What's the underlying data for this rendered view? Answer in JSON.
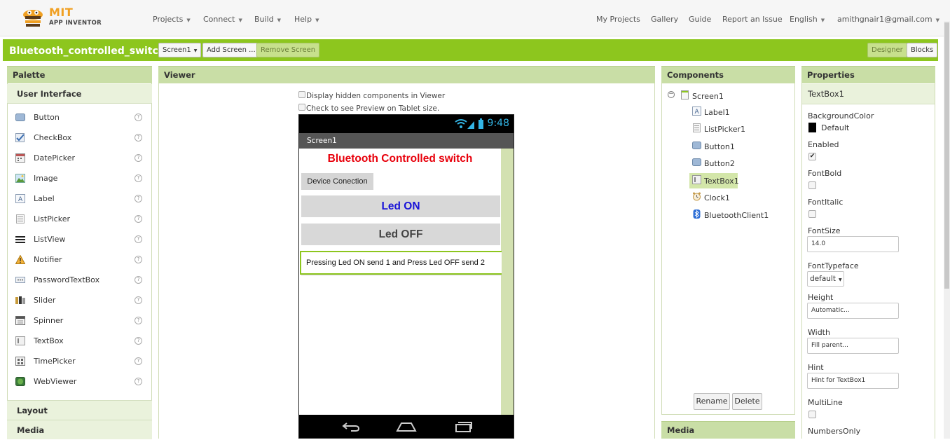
{
  "brand": {
    "line1": "MIT",
    "line2": "APP INVENTOR"
  },
  "nav": {
    "left": [
      "Projects",
      "Connect",
      "Build",
      "Help"
    ],
    "my_projects": "My Projects",
    "gallery": "Gallery",
    "guide": "Guide",
    "report": "Report an Issue",
    "language": "English",
    "user": "amithgnair1@gmail.com"
  },
  "project": {
    "name": "Bluetooth_controlled_switch",
    "screen_select": "Screen1",
    "add_screen": "Add Screen ...",
    "remove_screen": "Remove Screen",
    "designer": "Designer",
    "blocks": "Blocks"
  },
  "palette": {
    "title": "Palette",
    "category": "User Interface",
    "items": [
      "Button",
      "CheckBox",
      "DatePicker",
      "Image",
      "Label",
      "ListPicker",
      "ListView",
      "Notifier",
      "PasswordTextBox",
      "Slider",
      "Spinner",
      "TextBox",
      "TimePicker",
      "WebViewer"
    ],
    "help": "?",
    "layout": "Layout",
    "media": "Media"
  },
  "viewer": {
    "title": "Viewer",
    "hidden_label": "Display hidden components in Viewer",
    "tablet_label": "Check to see Preview on Tablet size.",
    "phone": {
      "time": "9:48",
      "screen_title": "Screen1",
      "app_title": "Bluetooth Controlled switch",
      "device_btn": "Device Conection",
      "led_on": "Led ON",
      "led_off": "Led OFF",
      "textbox": "Pressing Led ON send 1 and Press Led OFF send 2"
    }
  },
  "components": {
    "title": "Components",
    "root": "Screen1",
    "items": [
      "Label1",
      "ListPicker1",
      "Button1",
      "Button2",
      "TextBox1",
      "Clock1",
      "BluetoothClient1"
    ],
    "selected": "TextBox1",
    "rename": "Rename",
    "delete": "Delete",
    "media": "Media"
  },
  "properties": {
    "title": "Properties",
    "component": "TextBox1",
    "background_color_label": "BackgroundColor",
    "background_color_value": "Default",
    "enabled_label": "Enabled",
    "enabled_value": "✔",
    "fontbold_label": "FontBold",
    "fontitalic_label": "FontItalic",
    "fontsize_label": "FontSize",
    "fontsize_value": "14.0",
    "typeface_label": "FontTypeface",
    "typeface_value": "default",
    "height_label": "Height",
    "height_value": "Automatic...",
    "width_label": "Width",
    "width_value": "Fill parent...",
    "hint_label": "Hint",
    "hint_value": "Hint for TextBox1",
    "multiline_label": "MultiLine",
    "numbersonly_label": "NumbersOnly"
  },
  "colors": {
    "accent_green": "#8dc61e",
    "panel_header": "#c9dea6",
    "title_red": "#e8000b",
    "led_on_blue": "#1a14d8",
    "clock_blue": "#33b5e5"
  }
}
